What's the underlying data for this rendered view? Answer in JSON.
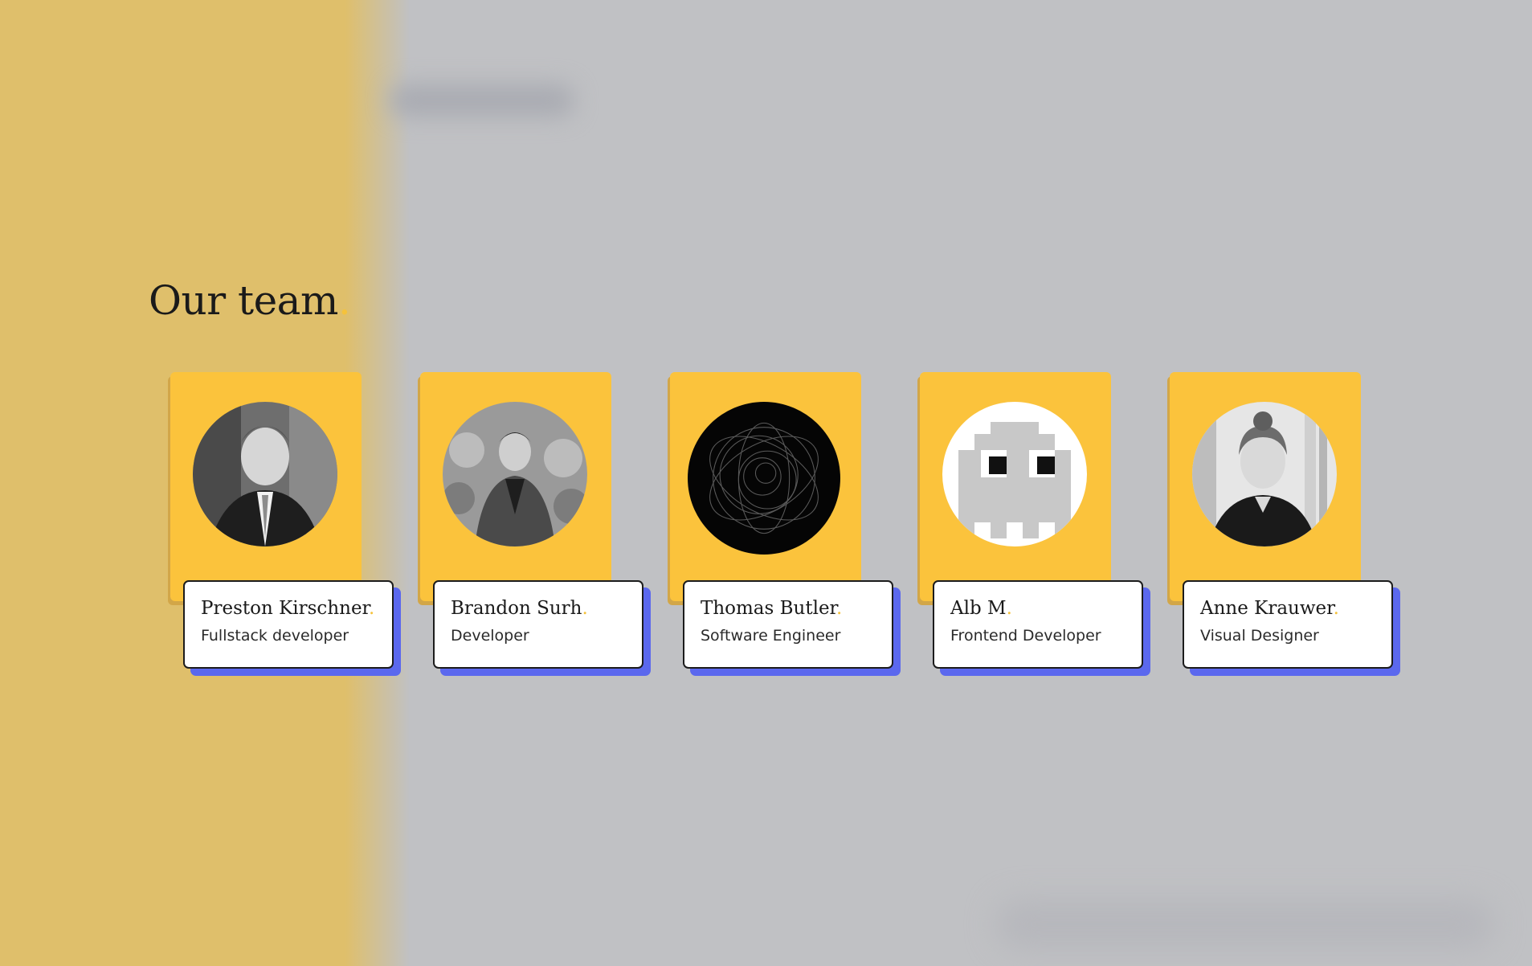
{
  "heading": {
    "text": "Our team",
    "accent": "."
  },
  "colors": {
    "card_yellow": "#fbc33c",
    "shadow_blue": "#5b68ee",
    "dot_accent": "#f5c23b",
    "overlay_gray": "#c0c1c4",
    "left_panel": "#dfbf6b"
  },
  "team": [
    {
      "name": "Preston Kirschner",
      "dot": ".",
      "role": "Fullstack developer",
      "avatar_icon": "portrait-photo-icon"
    },
    {
      "name": "Brandon Surh",
      "dot": ".",
      "role": "Developer",
      "avatar_icon": "portrait-photo-icon"
    },
    {
      "name": "Thomas Butler",
      "dot": ".",
      "role": "Software Engineer",
      "avatar_icon": "spiral-art-icon"
    },
    {
      "name": "Alb M",
      "dot": ".",
      "role": "Frontend Developer",
      "avatar_icon": "pixel-ghost-icon"
    },
    {
      "name": "Anne Krauwer",
      "dot": ".",
      "role": "Visual Designer",
      "avatar_icon": "portrait-photo-icon"
    }
  ]
}
